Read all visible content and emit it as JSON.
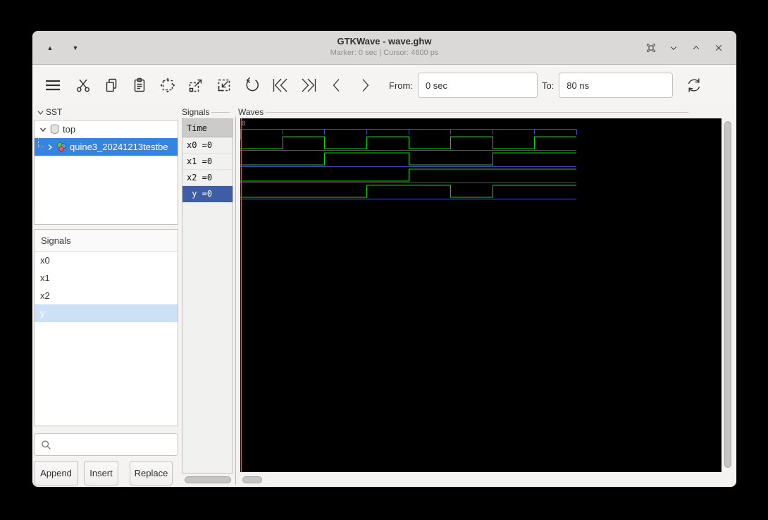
{
  "window": {
    "title": "GTKWave - wave.ghw",
    "subtitle": "Marker: 0 sec  |  Cursor: 4600 ps"
  },
  "toolbar": {
    "from_label": "From:",
    "from_value": "0 sec",
    "to_label": "To:",
    "to_value": "80 ns"
  },
  "sst": {
    "label": "SST",
    "items": [
      {
        "label": "top",
        "selected": false
      },
      {
        "label": "quine3_20241213testbe",
        "selected": true
      }
    ]
  },
  "signal_browser": {
    "header": "Signals",
    "items": [
      {
        "label": "x0",
        "selected": false
      },
      {
        "label": "x1",
        "selected": false
      },
      {
        "label": "x2",
        "selected": false
      },
      {
        "label": "y",
        "selected": true
      }
    ]
  },
  "search": {
    "placeholder": ""
  },
  "actions": {
    "append": "Append",
    "insert": "Insert",
    "replace": "Replace"
  },
  "wave_names": {
    "frame_label": "Signals",
    "time_header": "Time",
    "rows": [
      {
        "display": "x0 =0",
        "selected": false
      },
      {
        "display": "x1 =0",
        "selected": false
      },
      {
        "display": "x2 =0",
        "selected": false
      },
      {
        "display": " y =0",
        "selected": true
      }
    ]
  },
  "waves": {
    "frame_label": "Waves",
    "origin_label": "0"
  },
  "wave_data": {
    "type": "digital-timing",
    "unit": "ns",
    "t_start": 0,
    "t_end": 80,
    "tick_interval_ns": 10,
    "marker_ns": 0,
    "signals": [
      {
        "name": "x0",
        "current_value": 0,
        "initial_level": 0,
        "edges_ns": [
          10,
          20,
          30,
          40,
          50,
          60,
          70
        ]
      },
      {
        "name": "x1",
        "current_value": 0,
        "initial_level": 0,
        "edges_ns": [
          20,
          40,
          60
        ]
      },
      {
        "name": "x2",
        "current_value": 0,
        "initial_level": 0,
        "edges_ns": [
          40
        ]
      },
      {
        "name": "y",
        "current_value": 0,
        "initial_level": 0,
        "edges_ns": [
          30,
          50,
          60
        ]
      }
    ],
    "colors": {
      "trace": "#00dc00",
      "grid": "#4343c8",
      "marker": "#d95555",
      "background": "#000000",
      "origin_text": "#9a9a9a"
    }
  }
}
